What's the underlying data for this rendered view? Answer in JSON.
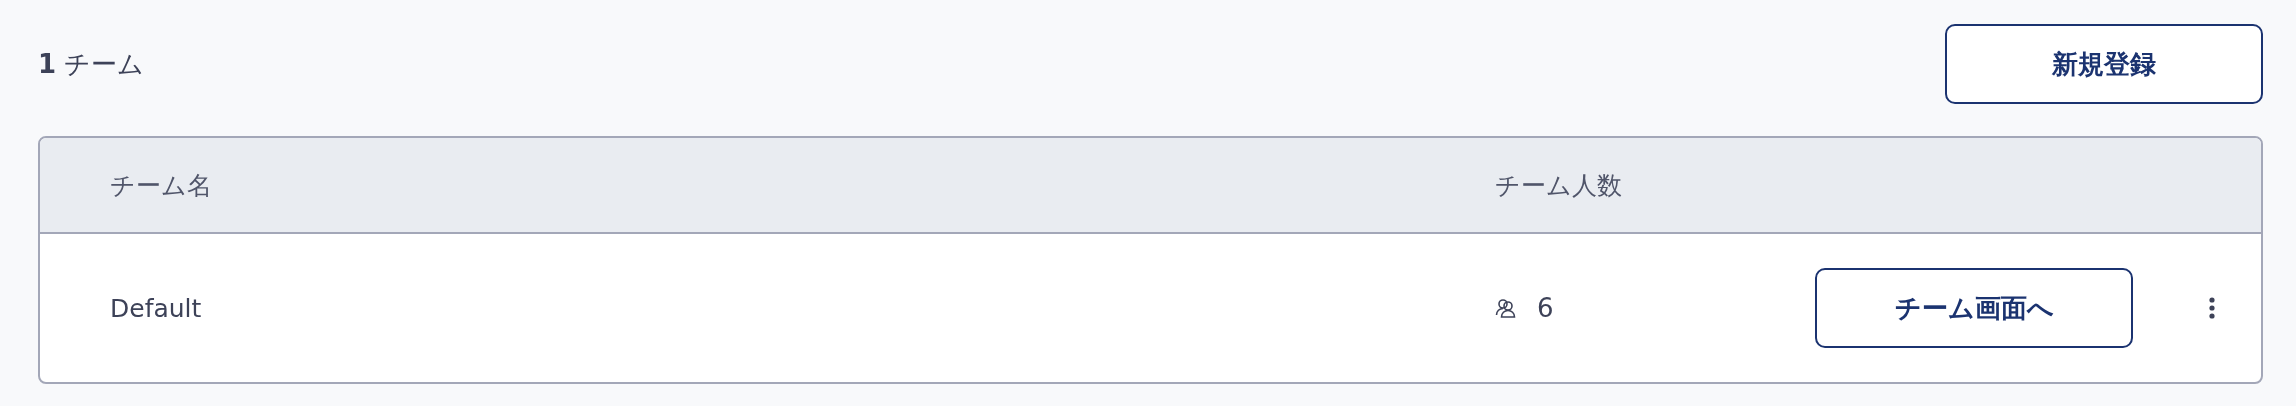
{
  "summary": {
    "count": "**1** チーム"
  },
  "create_button": "新規登録",
  "table": {
    "columns": [
      "チーム名",
      "チーム人数"
    ],
    "rows": [
      {
        "name": "Default",
        "members": "6",
        "action": "チーム画面へ"
      }
    ]
  }
}
